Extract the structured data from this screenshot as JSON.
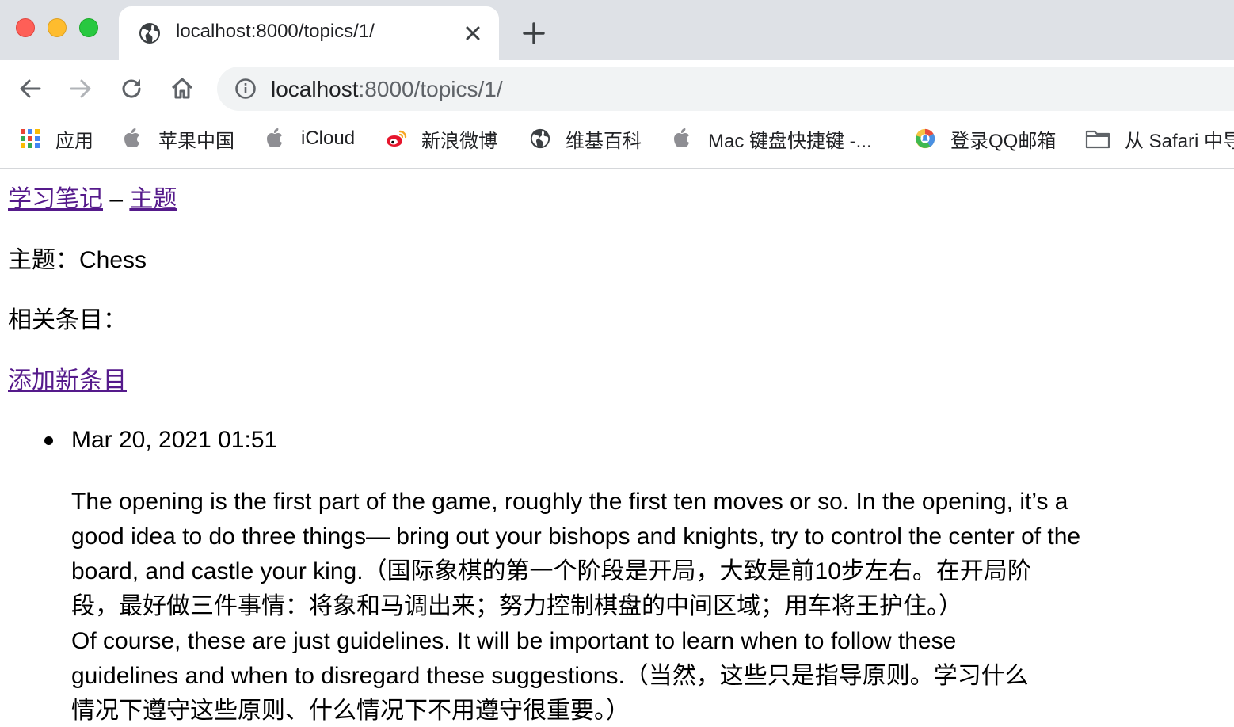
{
  "tab": {
    "title": "localhost:8000/topics/1/"
  },
  "address_bar": {
    "host": "localhost",
    "rest": ":8000/topics/1/"
  },
  "bookmarks": [
    {
      "label": "应用",
      "icon": "apps-grid-icon"
    },
    {
      "label": "苹果中国",
      "icon": "apple-icon"
    },
    {
      "label": "iCloud",
      "icon": "apple-icon"
    },
    {
      "label": "新浪微博",
      "icon": "weibo-icon"
    },
    {
      "label": "维基百科",
      "icon": "globe-icon"
    },
    {
      "label": "Mac 键盘快捷键 -...",
      "icon": "apple-icon"
    },
    {
      "label": "登录QQ邮箱",
      "icon": "qq-mail-icon"
    },
    {
      "label": "从 Safari 中导",
      "icon": "folder-icon"
    }
  ],
  "page": {
    "breadcrumb": {
      "home_link": "学习笔记",
      "separator": " – ",
      "topics_link": "主题"
    },
    "topic_heading": "主题：Chess",
    "entries_heading": "相关条目：",
    "add_entry_link": "添加新条目",
    "entries": [
      {
        "date": "Mar 20, 2021 01:51",
        "lines": [
          "The opening is the first part of the game, roughly the first ten moves or so. In the opening, it’s a",
          "good idea to do three things— bring out your bishops and knights, try to control the center of the",
          "board, and castle your king.（国际象棋的第一个阶段是开局，大致是前10步左右。在开局阶",
          "段，最好做三件事情：将象和马调出来；努力控制棋盘的中间区域；用车将王护住。）",
          "Of course, these are just guidelines. It will be important to learn when to follow these",
          "guidelines and when to disregard these suggestions.（当然，这些只是指导原则。学习什么",
          "情况下遵守这些原则、什么情况下不用遵守很重要。）"
        ]
      }
    ]
  },
  "colors": {
    "link": "#551a8b",
    "tabstrip": "#dee1e6",
    "omnibox": "#f1f3f4"
  }
}
